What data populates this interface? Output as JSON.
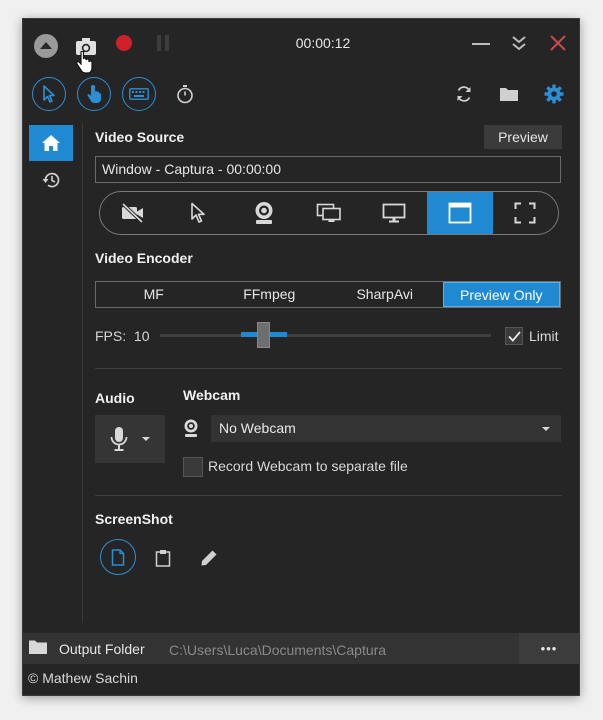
{
  "titlebar": {
    "timer": "00:00:12"
  },
  "toolbar": {
    "mode_buttons": [
      "cursor",
      "mouse-click",
      "keyboard"
    ]
  },
  "video_source": {
    "title": "Video Source",
    "preview_label": "Preview",
    "current": "Window  -  Captura - 00:00:00",
    "selected_index": 5
  },
  "video_encoder": {
    "title": "Video Encoder",
    "options": [
      "MF",
      "FFmpeg",
      "SharpAvi",
      "Preview Only"
    ],
    "selected": "Preview Only"
  },
  "fps": {
    "label": "FPS:",
    "value": "10",
    "limit_label": "Limit",
    "limit_checked": true
  },
  "audio": {
    "title": "Audio"
  },
  "webcam": {
    "title": "Webcam",
    "selected": "No Webcam",
    "separate_file_label": "Record Webcam to separate file"
  },
  "screenshot": {
    "title": "ScreenShot"
  },
  "footer": {
    "output_folder_label": "Output Folder",
    "output_path": "C:\\Users\\Luca\\Documents\\Captura",
    "more_label": "•••"
  },
  "copyright": "© Mathew Sachin",
  "colors": {
    "accent": "#1f8ad2",
    "record": "#d0212b",
    "close": "#c94a4a",
    "background": "#252525"
  }
}
